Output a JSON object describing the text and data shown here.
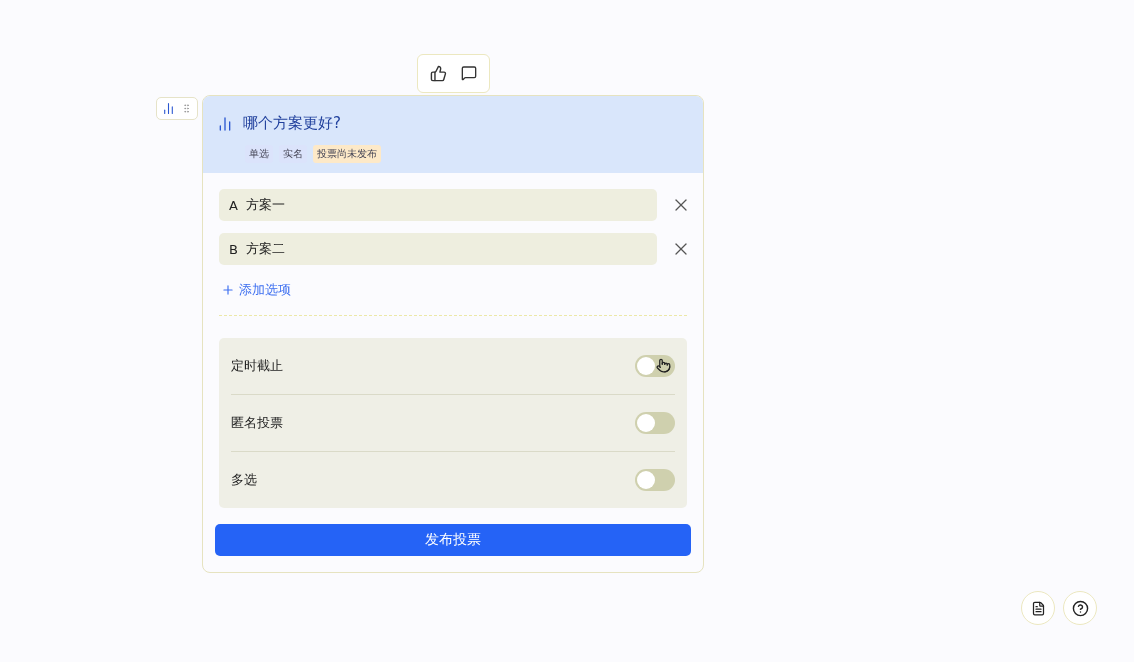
{
  "poll": {
    "title": "哪个方案更好?",
    "tags": [
      {
        "label": "单选",
        "color": "#dbe3fb"
      },
      {
        "label": "实名",
        "color": "#dbe3fb"
      },
      {
        "label": "投票尚未发布",
        "color": "#fde9c8"
      }
    ],
    "options": [
      {
        "letter": "A",
        "text": "方案一"
      },
      {
        "letter": "B",
        "text": "方案二"
      }
    ],
    "add_option": "添加选项",
    "settings": [
      {
        "label": "定时截止",
        "on": false
      },
      {
        "label": "匿名投票",
        "on": false
      },
      {
        "label": "多选",
        "on": false
      }
    ],
    "publish_button": "发布投票"
  }
}
